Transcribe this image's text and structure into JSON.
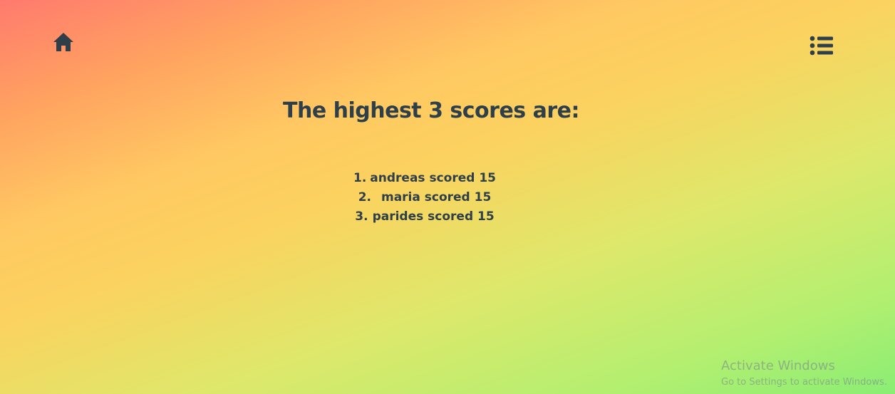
{
  "nav": {
    "home_icon": "home-icon",
    "menu_icon": "list-menu-icon"
  },
  "page": {
    "heading": "The highest 3 scores are:"
  },
  "scores": [
    {
      "rank": "1.",
      "text": "andreas scored 15"
    },
    {
      "rank": "2.",
      "text": "maria scored 15"
    },
    {
      "rank": "3.",
      "text": "parides scored 15"
    }
  ],
  "watermark": {
    "title": "Activate Windows",
    "subtitle": "Go to Settings to activate Windows."
  },
  "colors": {
    "text": "#2f3f4a",
    "gradient": [
      "#ff7a6e",
      "#ffa260",
      "#ffc862",
      "#dee86b",
      "#8aee74"
    ]
  }
}
